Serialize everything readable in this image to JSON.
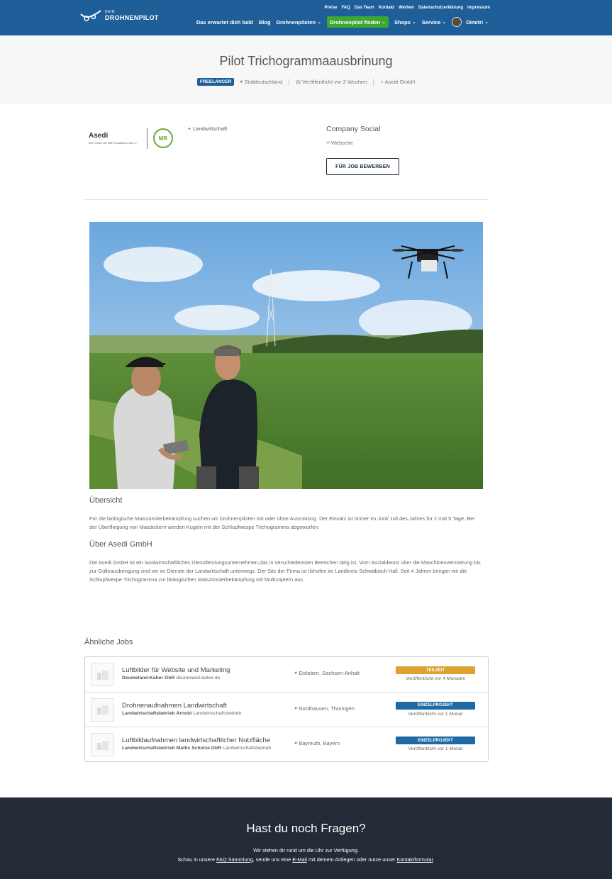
{
  "header": {
    "logo_small": "DEIN",
    "logo_big": "DROHNENPILOT",
    "utility_nav": [
      "Preise",
      "FAQ",
      "Das Team",
      "Kontakt",
      "Werben",
      "Datenschutzerklärung",
      "Impressum"
    ],
    "main_nav": [
      {
        "label": "Das erwartet dich bald",
        "dropdown": false,
        "active": false
      },
      {
        "label": "Blog",
        "dropdown": false,
        "active": false
      },
      {
        "label": "Drohnenpiloten",
        "dropdown": true,
        "active": false
      },
      {
        "label": "Drohnenpilot finden",
        "dropdown": true,
        "active": true
      },
      {
        "label": "Shops",
        "dropdown": true,
        "active": false
      },
      {
        "label": "Service",
        "dropdown": true,
        "active": false
      }
    ],
    "user_name": "Dimitri",
    "colors": {
      "bar": "#1f5f99",
      "active": "#3ca832"
    }
  },
  "job": {
    "title": "Pilot Trichogrammaausbrinung",
    "type_badge": "FREELANCER",
    "location": "Süddeutschland",
    "published": "Veröffentlicht vor 2 Wochen",
    "company": "Asedi GmbH"
  },
  "company": {
    "logo_name": "Asedi",
    "logo_tagline": "Eine Tochter des MBR Schwäbisch Hall e.V.",
    "logo_badge": "MR",
    "category": "Landwirtschaft",
    "social_title": "Company Social",
    "website_label": "Webseite",
    "apply_label": "FÜR JOB BEWERBEN"
  },
  "content": {
    "overview_title": "Übersicht",
    "overview_text": "Für die biologische Maiszünslerbekämpfung suchen wir Drohnenpiloten mit oder ohne Ausrüstung. Der Einsatz ist immer im Juni/ Juli des Jahres für 2 mal 5 Tage. Bei der Überfliegung von Maisäckern werden Kugeln mit der Schlupfwespe Trichogramma abgeworfen.",
    "about_title": "Über Asedi GmbH",
    "about_text": "Die Asedi GmbH ist ein landwirtschaftliches Dienstleistungsunternehmen,das in verschiedensten Bereichen tätig ist. Vom Sozialdienst über die Maschinenvermietung bis zur Gülleausbringung sind wir im Dienste der Landwirtschaft unterwegs. Der Sitz der Firma ist Ilshofen im Landkreis Schwäbisch Hall. Seit 4 Jahren bringen wir die Schlupfwespe Trichogramma zur biologischen Maiszünslerbekämpfung mit Multicoptern aus."
  },
  "similar": {
    "title": "Ähnliche Jobs",
    "jobs": [
      {
        "title": "Luftbilder für Website und Marketing",
        "company": "Deumeland-Kaher GbR",
        "company_extra": "deumeland-kaher.de",
        "location": "Eisleben, Sachsen-Anhalt",
        "badge": "TEILZEIT",
        "badge_color": "#e0a133",
        "posted": "Veröffentlicht vor 4 Monaten"
      },
      {
        "title": "Drohnenaufnahmen Landwirtschaft",
        "company": "Landwirtschaftsbetrieb Arnold",
        "company_extra": "Landwirtschaftsbetrieb",
        "location": "Nordhausen, Thüringen",
        "badge": "EINZELPROJEKT",
        "badge_color": "#1f6aa5",
        "posted": "Veröffentlicht vor 1 Monat"
      },
      {
        "title": "Luftbildaufnahmen landwirtschaftlicher Nutzfläche",
        "company": "Landwirtschaftsbetrieb Mattis Schulze GbR",
        "company_extra": "Landwirtschaftsbetrieb",
        "location": "Bayreuth, Bayern",
        "badge": "EINZELPROJEKT",
        "badge_color": "#1f6aa5",
        "posted": "Veröffentlicht vor 1 Monat"
      }
    ]
  },
  "footer": {
    "title": "Hast du noch Fragen?",
    "line1": "Wir stehen dir rund um die Uhr zur Verfügung.",
    "line2_a": "Schau in unsere ",
    "line2_link1": "FAQ Sammlung",
    "line2_b": ", sende uns eine ",
    "line2_link2": "E-Mail",
    "line2_c": " mit deinem Anliegen oder nutze unser ",
    "line2_link3": "Kontaktformular",
    "line2_d": "."
  }
}
